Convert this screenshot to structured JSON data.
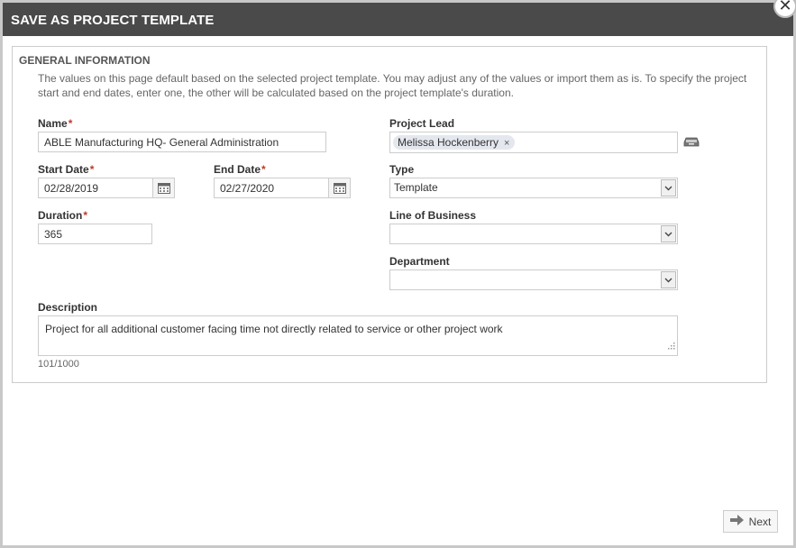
{
  "dialog": {
    "title": "SAVE AS PROJECT TEMPLATE",
    "close_symbol": "✕"
  },
  "section": {
    "title": "GENERAL INFORMATION",
    "intro": "The values on this page default based on the selected project template. You may adjust any of the values or import them as is. To specify the project start and end dates, enter one, the other will be calculated based on the project template's duration."
  },
  "form": {
    "name": {
      "label": "Name",
      "required_mark": "*",
      "value": "ABLE Manufacturing HQ- General Administration"
    },
    "start_date": {
      "label": "Start Date",
      "required_mark": "*",
      "value": "02/28/2019"
    },
    "end_date": {
      "label": "End Date",
      "required_mark": "*",
      "value": "02/27/2020"
    },
    "duration": {
      "label": "Duration",
      "required_mark": "*",
      "value": "365"
    },
    "project_lead": {
      "label": "Project Lead",
      "token": "Melissa Hockenberry",
      "token_remove": "×"
    },
    "type": {
      "label": "Type",
      "value": "Template"
    },
    "line_of_business": {
      "label": "Line of Business",
      "value": ""
    },
    "department": {
      "label": "Department",
      "value": ""
    },
    "description": {
      "label": "Description",
      "value": "Project for all additional customer facing time not directly related to service or other project work",
      "counter": "101/1000"
    }
  },
  "footer": {
    "next_label": "Next"
  },
  "icons": {
    "calendar": "calendar-icon",
    "lookup": "address-book-icon",
    "dropdown": "chevron-down-icon",
    "next": "arrow-right-icon"
  }
}
